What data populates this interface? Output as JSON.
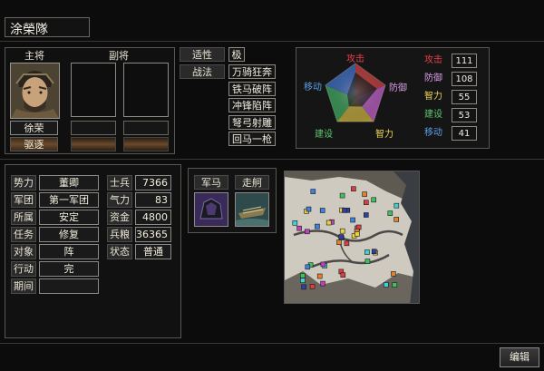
{
  "unit_name": "涂榮隊",
  "officers": {
    "main_header": "主将",
    "main_name": "徐荣",
    "main_trait": "驱逐",
    "deputy_header": "副将"
  },
  "aptitude": {
    "label": "适性",
    "value": "极"
  },
  "tactics": {
    "label": "战法",
    "items": [
      "万骑狂奔",
      "铁马破阵",
      "冲锋陷阵",
      "弩弓射雕",
      "回马一枪"
    ]
  },
  "radar": {
    "labels": {
      "attack": "攻击",
      "defense": "防御",
      "intellect": "智力",
      "build": "建设",
      "move": "移动"
    },
    "values": {
      "attack": 111,
      "defense": 108,
      "intellect": 55,
      "build": 53,
      "move": 41
    },
    "label_colors": {
      "attack": "#e6404a",
      "defense": "#d8a0e8",
      "intellect": "#e8d25a",
      "build": "#5ec870",
      "move": "#58a0e8"
    }
  },
  "stats": [
    {
      "label": "攻击",
      "value": "111",
      "color": "#e6404a"
    },
    {
      "label": "防御",
      "value": "108",
      "color": "#d8a0e8"
    },
    {
      "label": "智力",
      "value": "55",
      "color": "#e8d25a"
    },
    {
      "label": "建设",
      "value": "53",
      "color": "#5ec870"
    },
    {
      "label": "移动",
      "value": "41",
      "color": "#58a0e8"
    }
  ],
  "info": [
    {
      "label": "势力",
      "value": "董卿"
    },
    {
      "label": "军团",
      "value": "第一军团"
    },
    {
      "label": "所属",
      "value": "安定"
    },
    {
      "label": "任务",
      "value": "修复"
    },
    {
      "label": "对象",
      "value": "阵"
    },
    {
      "label": "行动",
      "value": "完"
    },
    {
      "label": "期间",
      "value": ""
    }
  ],
  "troops": [
    {
      "label": "士兵",
      "value": "7366"
    },
    {
      "label": "气力",
      "value": "83"
    },
    {
      "label": "资金",
      "value": "4800"
    },
    {
      "label": "兵粮",
      "value": "36365"
    },
    {
      "label": "状态",
      "value": "普通"
    }
  ],
  "equipment": {
    "horse_label": "军马",
    "ship_label": "走舸"
  },
  "edit_button": "编辑"
}
